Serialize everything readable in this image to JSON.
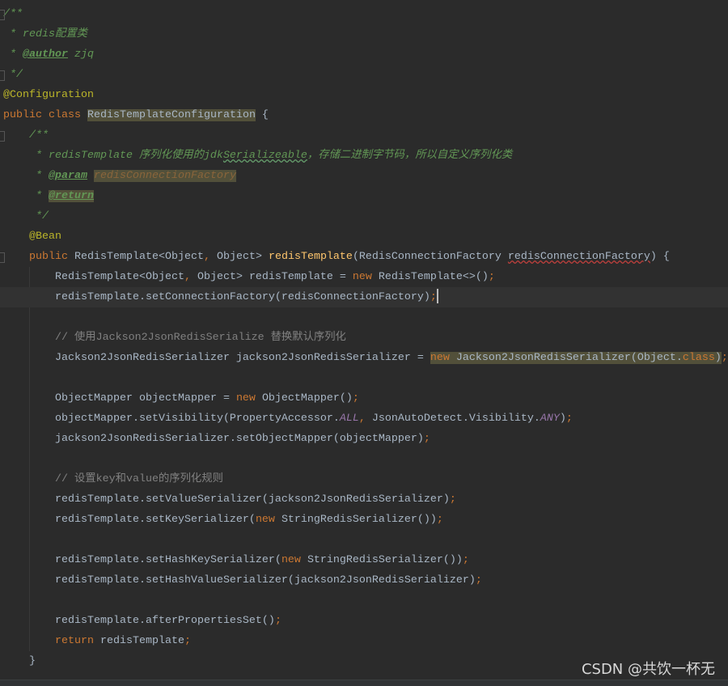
{
  "editor": {
    "current_line": 14,
    "lines": [
      [
        [
          "/**",
          "doc"
        ]
      ],
      [
        [
          " * redis配置类",
          "doc"
        ]
      ],
      [
        [
          " * ",
          "doc"
        ],
        [
          "@author",
          "tag"
        ],
        [
          " zjq",
          "doc"
        ]
      ],
      [
        [
          " */",
          "doc"
        ]
      ],
      [
        [
          "@Configuration",
          "ann"
        ]
      ],
      [
        [
          "public class ",
          "kw"
        ],
        [
          "RedisTemplateConfiguration",
          "hl"
        ],
        [
          " {",
          ""
        ]
      ],
      [
        [
          "    /**",
          "doc"
        ]
      ],
      [
        [
          "     * redisTemplate 序列化使用的jdk",
          "doc"
        ],
        [
          "Serializeable",
          "doc typo"
        ],
        [
          "，存储二进制字节码，所以自定义序列化类",
          "doc"
        ]
      ],
      [
        [
          "     * ",
          "doc"
        ],
        [
          "@param",
          "tag"
        ],
        [
          " ",
          ""
        ],
        [
          "redisConnectionFactory",
          "dparam hl"
        ]
      ],
      [
        [
          "     * ",
          "doc"
        ],
        [
          "@return",
          "tag hl"
        ]
      ],
      [
        [
          "     */",
          "doc"
        ]
      ],
      [
        [
          "    @Bean",
          "ann"
        ]
      ],
      [
        [
          "    public ",
          "kw"
        ],
        [
          "RedisTemplate<Object",
          ""
        ],
        [
          ", ",
          "pn"
        ],
        [
          "Object> ",
          ""
        ],
        [
          "redisTemplate",
          "fn"
        ],
        [
          "(RedisConnectionFactory ",
          ""
        ],
        [
          "redisConnectionFactory",
          "err"
        ],
        [
          ") {",
          ""
        ]
      ],
      [
        [
          "        RedisTemplate<Object",
          ""
        ],
        [
          ", ",
          "pn"
        ],
        [
          "Object> redisTemplate = ",
          ""
        ],
        [
          "new ",
          "kw"
        ],
        [
          "RedisTemplate<>()",
          ""
        ],
        [
          ";",
          "pn"
        ]
      ],
      [
        [
          "        redisTemplate.setConnectionFactory(redisConnectionFactory)",
          ""
        ],
        [
          ";",
          "pn"
        ],
        [
          "",
          "caret"
        ]
      ],
      [],
      [
        [
          "        // 使用Jackson2JsonRedisSerialize 替换默认序列化",
          "cm"
        ]
      ],
      [
        [
          "        Jackson2JsonRedisSerializer jackson2JsonRedisSerializer = ",
          ""
        ],
        [
          "new ",
          "kw hl"
        ],
        [
          "Jackson2JsonRedisSerializer(Object.",
          "hl"
        ],
        [
          "class",
          "kw hl"
        ],
        [
          ")",
          "hl"
        ],
        [
          ";",
          "pn"
        ]
      ],
      [],
      [
        [
          "        ObjectMapper objectMapper = ",
          ""
        ],
        [
          "new ",
          "kw"
        ],
        [
          "ObjectMapper()",
          ""
        ],
        [
          ";",
          "pn"
        ]
      ],
      [
        [
          "        objectMapper.setVisibility(PropertyAccessor.",
          ""
        ],
        [
          "ALL",
          "cst"
        ],
        [
          ", ",
          "pn"
        ],
        [
          "JsonAutoDetect.Visibility.",
          ""
        ],
        [
          "ANY",
          "cst"
        ],
        [
          ")",
          ""
        ],
        [
          ";",
          "pn"
        ]
      ],
      [
        [
          "        jackson2JsonRedisSerializer.setObjectMapper(objectMapper)",
          ""
        ],
        [
          ";",
          "pn"
        ]
      ],
      [],
      [
        [
          "        // 设置key和value的序列化规则",
          "cm"
        ]
      ],
      [
        [
          "        redisTemplate.setValueSerializer(jackson2JsonRedisSerializer)",
          ""
        ],
        [
          ";",
          "pn"
        ]
      ],
      [
        [
          "        redisTemplate.setKeySerializer(",
          ""
        ],
        [
          "new ",
          "kw"
        ],
        [
          "StringRedisSerializer())",
          ""
        ],
        [
          ";",
          "pn"
        ]
      ],
      [],
      [
        [
          "        redisTemplate.setHashKeySerializer(",
          ""
        ],
        [
          "new ",
          "kw"
        ],
        [
          "StringRedisSerializer())",
          ""
        ],
        [
          ";",
          "pn"
        ]
      ],
      [
        [
          "        redisTemplate.setHashValueSerializer(jackson2JsonRedisSerializer)",
          ""
        ],
        [
          ";",
          "pn"
        ]
      ],
      [],
      [
        [
          "        redisTemplate.afterPropertiesSet()",
          ""
        ],
        [
          ";",
          "pn"
        ]
      ],
      [
        [
          "        return ",
          "kw"
        ],
        [
          "redisTemplate",
          ""
        ],
        [
          ";",
          "pn"
        ]
      ],
      [
        [
          "    }",
          ""
        ]
      ]
    ]
  },
  "watermark": "CSDN @共饮一杯无"
}
